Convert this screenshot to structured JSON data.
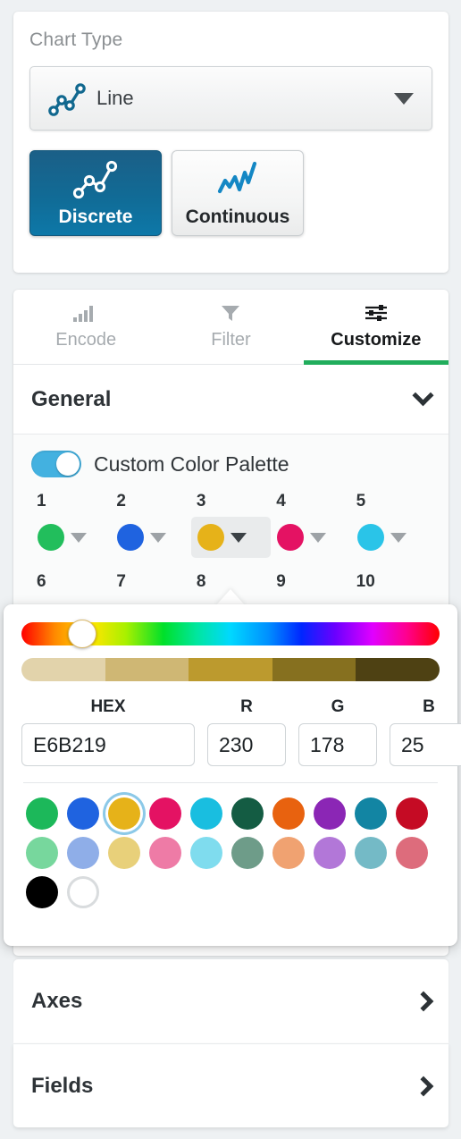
{
  "chart_type": {
    "section_label": "Chart Type",
    "selected": "Line",
    "select_icon": "line-chart-icon",
    "dropdown_icon": "caret-down-icon",
    "modes": [
      {
        "label": "Discrete",
        "icon": "discrete-line-icon",
        "active": true
      },
      {
        "label": "Continuous",
        "icon": "continuous-line-icon",
        "active": false
      }
    ],
    "active_color": "#116B96"
  },
  "tabs": [
    {
      "label": "Encode",
      "icon": "bar-chart-icon",
      "active": false
    },
    {
      "label": "Filter",
      "icon": "funnel-icon",
      "active": false
    },
    {
      "label": "Customize",
      "icon": "sliders-icon",
      "active": true
    }
  ],
  "tab_accent": "#21AD5C",
  "general": {
    "title": "General",
    "expanded": true,
    "chevron_icon": "chevron-down-icon"
  },
  "custom_palette": {
    "toggle_label": "Custom Color Palette",
    "toggle_on": true,
    "toggle_color": "#43B1E0",
    "row1_numbers": [
      "1",
      "2",
      "3",
      "4",
      "5"
    ],
    "row1_colors": [
      "#22BE5C",
      "#1F63E0",
      "#E6B219",
      "#E41263",
      "#2AC4E8"
    ],
    "row2_numbers": [
      "6",
      "7",
      "8",
      "9",
      "10"
    ],
    "selected_index": 3
  },
  "color_picker": {
    "hue_handle_percent": 11,
    "shades": [
      "#E2D3AB",
      "#CFB774",
      "#BC9A2E",
      "#86701F",
      "#4E4113"
    ],
    "fields": [
      {
        "label": "HEX",
        "value": "E6B219",
        "name": "hex-input"
      },
      {
        "label": "R",
        "value": "230",
        "name": "red-input"
      },
      {
        "label": "G",
        "value": "178",
        "name": "green-input"
      },
      {
        "label": "B",
        "value": "25",
        "name": "blue-input"
      }
    ],
    "swatch_row_1": [
      "#1CB85A",
      "#1F63E0",
      "#E6B219",
      "#E41263",
      "#19BEE0",
      "#145C43",
      "#E8620F",
      "#8B26B5",
      "#1285A3",
      "#C50B24"
    ],
    "swatch_row_2": [
      "#77D79D",
      "#8FAEE8",
      "#E8D07A",
      "#EE7BA6",
      "#7FDCEE",
      "#6E9C89",
      "#F0A271",
      "#B277D8",
      "#74BAC6",
      "#DD6C7C"
    ],
    "swatch_row_3": [
      "#000000",
      "#FFFFFF"
    ],
    "selected_swatch": "#E6B219",
    "selected_row": 1,
    "selected_col": 2
  },
  "bottom_rows": [
    {
      "title": "Axes",
      "chevron_icon": "chevron-right-icon"
    },
    {
      "title": "Fields",
      "chevron_icon": "chevron-right-icon"
    }
  ]
}
